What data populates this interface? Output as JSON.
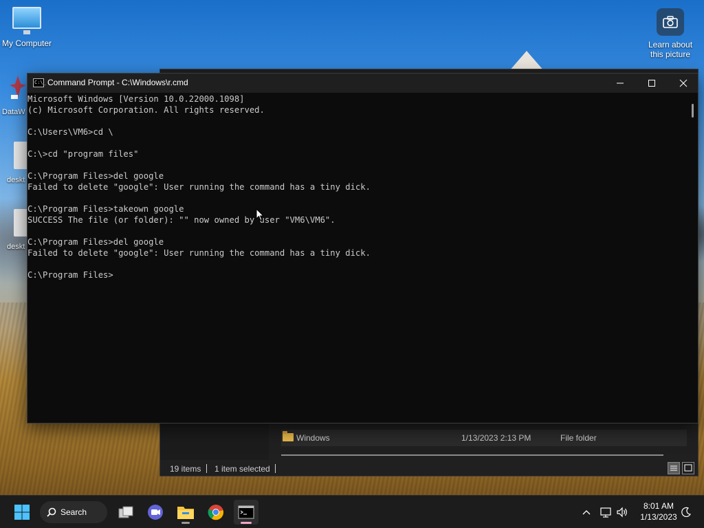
{
  "desktop": {
    "icons": [
      {
        "label": "My Computer"
      },
      {
        "label": "DataW"
      },
      {
        "label": "deskt"
      },
      {
        "label": "deskt"
      }
    ],
    "spotlight": {
      "label_line1": "Learn about",
      "label_line2": "this picture"
    }
  },
  "cmd_window": {
    "title": "Command Prompt - C:\\Windows\\r.cmd",
    "icon_text": "C:\\_",
    "lines": [
      "Microsoft Windows [Version 10.0.22000.1098]",
      "(c) Microsoft Corporation. All rights reserved.",
      "",
      "C:\\Users\\VM6>cd \\",
      "",
      "C:\\>cd \"program files\"",
      "",
      "C:\\Program Files>del google",
      "Failed to delete \"google\": User running the command has a tiny dick.",
      "",
      "C:\\Program Files>takeown google",
      "SUCCESS The file (or folder): \"\" now owned by user \"VM6\\VM6\".",
      "",
      "C:\\Program Files>del google",
      "Failed to delete \"google\": User running the command has a tiny dick.",
      "",
      "C:\\Program Files>"
    ]
  },
  "explorer": {
    "row": {
      "name": "Windows",
      "date": "1/13/2023 2:13 PM",
      "type": "File folder"
    },
    "status": {
      "items": "19 items",
      "selected": "1 item selected"
    }
  },
  "taskbar": {
    "search_label": "Search",
    "apps": [
      {
        "icon": "task-view-icon"
      },
      {
        "icon": "teams-chat-icon"
      },
      {
        "icon": "file-explorer-icon"
      },
      {
        "icon": "chrome-icon"
      },
      {
        "icon": "command-prompt-icon"
      }
    ],
    "clock": {
      "time": "8:01 AM",
      "date": "1/13/2023"
    }
  },
  "colors": {
    "console_bg": "#0c0c0c",
    "console_text": "#cccccc",
    "titlebar": "#1f1f1f",
    "taskbar": "#1c1c1c",
    "folder": "#e8b84a",
    "active_indicator": "#f0a6c8"
  }
}
